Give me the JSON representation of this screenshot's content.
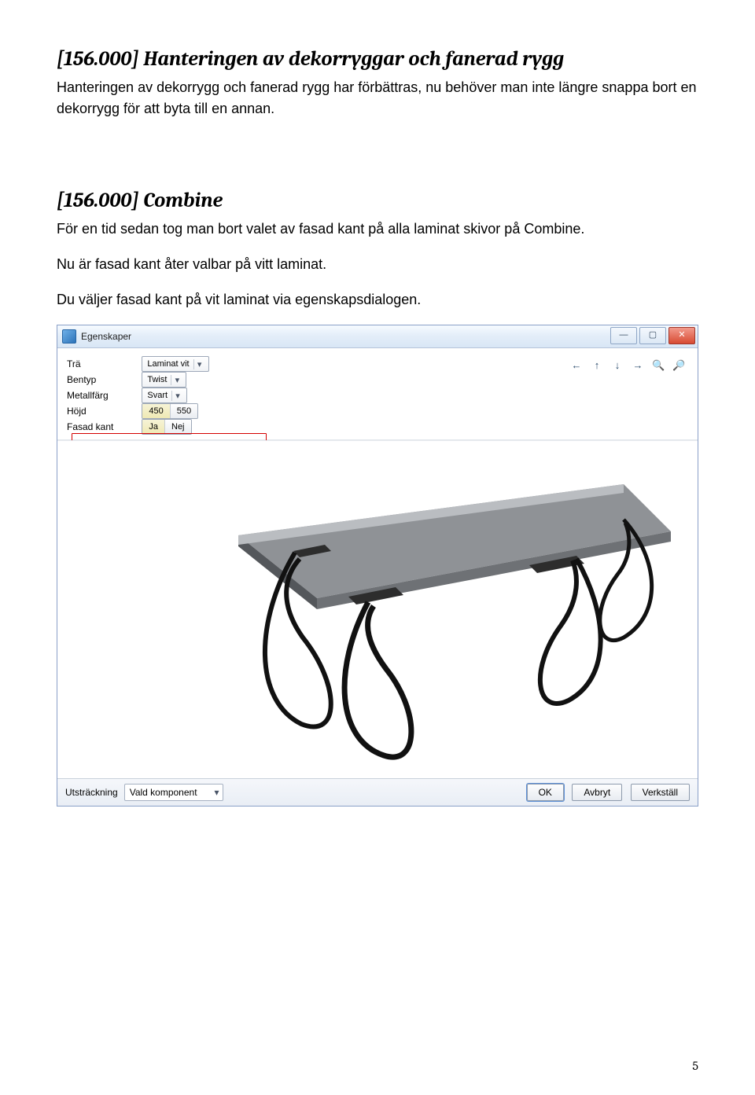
{
  "section1": {
    "heading": "[156.000] Hanteringen av dekorryggar och fanerad rygg",
    "para": "Hanteringen av dekorrygg och fanerad rygg har förbättras, nu behöver man inte längre snappa bort en dekorrygg för att byta till en annan."
  },
  "section2": {
    "heading": "[156.000] Combine",
    "para1": "För en tid sedan tog man bort valet av fasad kant på alla laminat skivor på Combine.",
    "para2": "Nu är fasad kant åter valbar på vitt laminat.",
    "para3": "Du väljer fasad kant på vit laminat via egenskapsdialogen."
  },
  "dialog": {
    "title": "Egenskaper",
    "winMin": "—",
    "winMax": "▢",
    "winClose": "✕",
    "navPrev": "←",
    "navUp": "↑",
    "navDown": "↓",
    "navNext": "→",
    "navZoomIn": "🔍+",
    "navZoomOut": "🔍-",
    "rows": {
      "tra": {
        "label": "Trä",
        "value": "Laminat vit"
      },
      "bentyp": {
        "label": "Bentyp",
        "value": "Twist"
      },
      "metall": {
        "label": "Metallfärg",
        "value": "Svart"
      },
      "hojd": {
        "label": "Höjd",
        "opt1": "450",
        "opt2": "550"
      },
      "fasad": {
        "label": "Fasad kant",
        "opt1": "Ja",
        "opt2": "Nej"
      }
    },
    "bottom": {
      "utstrLabel": "Utsträckning",
      "utstrValue": "Vald komponent",
      "ok": "OK",
      "cancel": "Avbryt",
      "apply": "Verkställ"
    }
  },
  "pageNum": "5"
}
